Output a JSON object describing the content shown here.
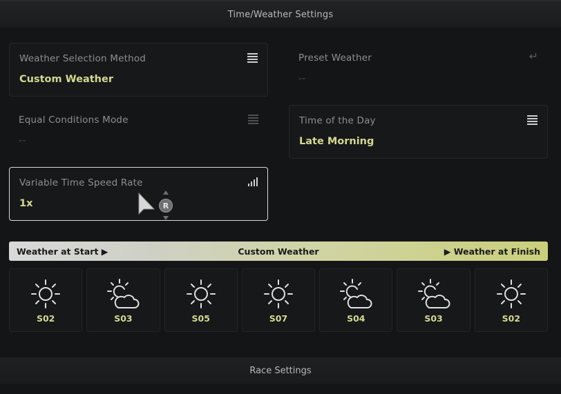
{
  "header": {
    "title": "Time/Weather Settings"
  },
  "cards": {
    "weather_selection": {
      "label": "Weather Selection Method",
      "value": "Custom Weather",
      "icon": "menu-icon"
    },
    "preset_weather": {
      "label": "Preset Weather",
      "value": "--",
      "icon": "return-icon"
    },
    "equal_conditions": {
      "label": "Equal Conditions Mode",
      "value": "--",
      "icon": "menu-icon"
    },
    "time_of_day": {
      "label": "Time of the Day",
      "value": "Late Morning",
      "icon": "menu-icon"
    },
    "time_speed": {
      "label": "Variable Time Speed Rate",
      "value": "1x",
      "icon": "signal-bars-icon"
    }
  },
  "controller": {
    "r_button": "R"
  },
  "weather_bar": {
    "start_label": "Weather at Start ▶",
    "center_label": "Custom Weather",
    "finish_label": "▶ Weather at Finish"
  },
  "slots": [
    {
      "code": "S02",
      "icon": "sun-icon"
    },
    {
      "code": "S03",
      "icon": "sun-cloud-icon"
    },
    {
      "code": "S05",
      "icon": "sun-icon"
    },
    {
      "code": "S07",
      "icon": "sun-icon"
    },
    {
      "code": "S04",
      "icon": "sun-cloud-icon"
    },
    {
      "code": "S03",
      "icon": "sun-cloud-icon"
    },
    {
      "code": "S02",
      "icon": "sun-icon"
    }
  ],
  "footer": {
    "title": "Race Settings"
  },
  "colors": {
    "accent": "#d4d98f",
    "bar_end": "#c9cf7a",
    "focus_border": "#d9d9d9"
  }
}
